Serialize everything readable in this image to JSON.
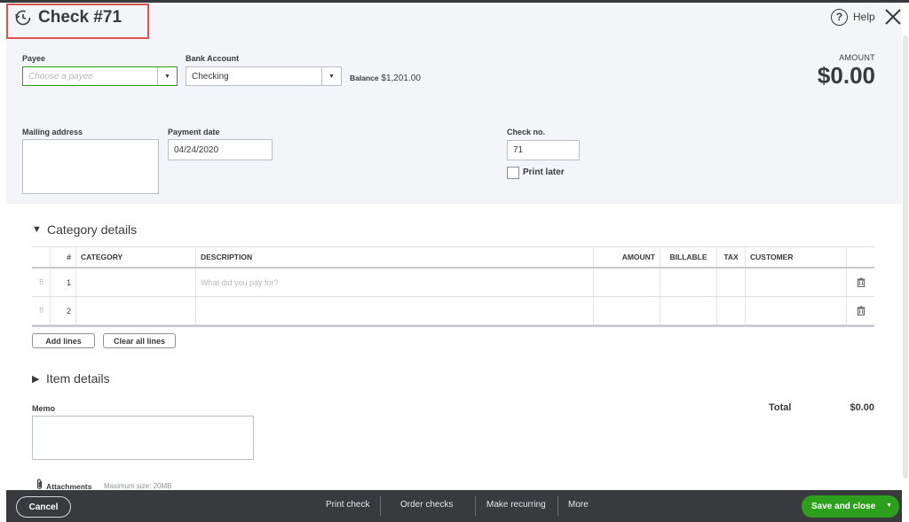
{
  "header": {
    "title": "Check #71",
    "help_label": "Help"
  },
  "form": {
    "payee_label": "Payee",
    "payee_placeholder": "Choose a payee",
    "bank_account_label": "Bank Account",
    "bank_account_value": "Checking",
    "balance_label": "Balance",
    "balance_value": "$1,201.00",
    "amount_label": "AMOUNT",
    "amount_value": "$0.00",
    "mailing_address_label": "Mailing address",
    "payment_date_label": "Payment date",
    "payment_date_value": "04/24/2020",
    "check_no_label": "Check no.",
    "check_no_value": "71",
    "print_later_label": "Print later"
  },
  "category": {
    "section_title": "Category details",
    "columns": [
      "#",
      "CATEGORY",
      "DESCRIPTION",
      "AMOUNT",
      "BILLABLE",
      "TAX",
      "CUSTOMER"
    ],
    "rows": [
      {
        "num": "1",
        "description_placeholder": "What did you pay for?"
      },
      {
        "num": "2",
        "description_placeholder": ""
      }
    ],
    "add_lines_label": "Add lines",
    "clear_all_lines_label": "Clear all lines"
  },
  "items": {
    "section_title": "Item details"
  },
  "memo": {
    "label": "Memo"
  },
  "totals": {
    "label": "Total",
    "value": "$0.00"
  },
  "attachments": {
    "label": "Attachments",
    "max_size": "Maximum size: 20MB"
  },
  "footer": {
    "cancel_label": "Cancel",
    "print_check_label": "Print check",
    "order_checks_label": "Order checks",
    "make_recurring_label": "Make recurring",
    "more_label": "More",
    "save_label": "Save and close"
  },
  "colors": {
    "accent": "#2ca01c",
    "footer_bg": "#393a3d",
    "header_bg": "#f4f5f8",
    "highlight": "#d9534f"
  }
}
